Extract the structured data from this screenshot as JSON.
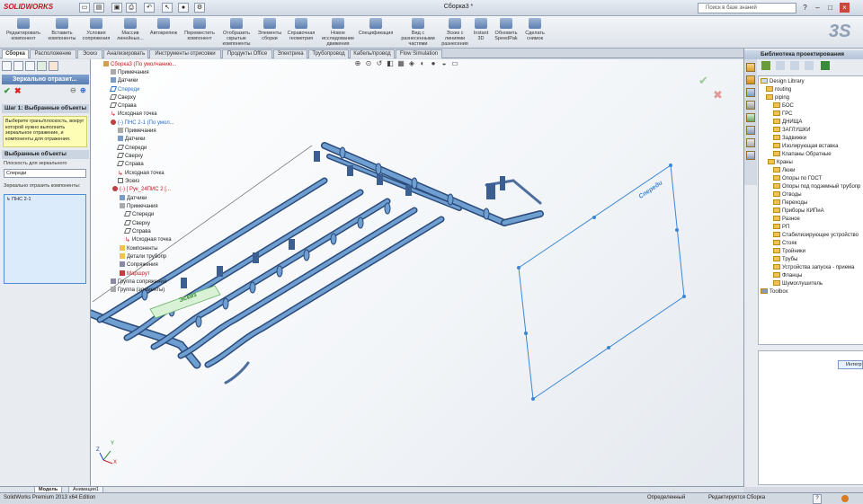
{
  "app": {
    "logo": "SOLIDWORKS",
    "doc_title": "Сборка3 *",
    "search_placeholder": "Поиск в базе знаний",
    "window_buttons": [
      "?",
      "–",
      "□",
      "×"
    ]
  },
  "quick_access": [
    "new-icon",
    "open-icon",
    "save-icon",
    "print-icon",
    "undo-icon",
    "select-icon",
    "rebuild-icon",
    "options-icon"
  ],
  "ribbon": {
    "buttons": [
      "Редактировать компонент",
      "Вставить компоненты",
      "Условия сопряжения",
      "Массив линейных...",
      "Автокрепеж",
      "Переместить компонент",
      "Отобразить скрытые компоненты",
      "Элементы сборки",
      "Справочная геометрия",
      "Новое исследование движения",
      "Спецификация",
      "Вид с разнесенными частями",
      "Эскиз с линиями разнесения",
      "Instant 3D",
      "Обновить SpeedPak",
      "Сделать снимок"
    ]
  },
  "tabs": [
    "Сборка",
    "Расположение",
    "Эскиз",
    "Анализировать",
    "Инструменты отрисовки",
    "Продукты Office",
    "Электрика",
    "Трубопровод",
    "Кабель/провод",
    "Flow Simulation"
  ],
  "property_manager": {
    "title": "Зеркально отразит...",
    "step_header": "Шаг 1: Выбранные объекты",
    "step_message": "Выберите грань/плоскость, вокруг которой нужно выполнить зеркальное отражение, и компоненты для отражения.",
    "selected_header": "Выбранные объекты",
    "plane_label": "Плоскость для зеркального",
    "plane_value": "Спереди",
    "components_label": "Зеркально отразить компоненты:",
    "components": [
      "ПНС 2-1"
    ]
  },
  "feature_tree": [
    "Сборка3 (По умолчанию...",
    "Примечания",
    "Датчики",
    "Спереди",
    "Сверху",
    "Справа",
    "Исходная точка",
    "(-) ПНС 2-1 (По умол...",
    "Примечания",
    "Датчики",
    "Спереди",
    "Сверху",
    "Справа",
    "Исходная точка",
    "Эскиз",
    "(-) [ Рук_24ПИС 2 [...",
    "Датчики",
    "Примечания",
    "Спереди",
    "Сверху",
    "Справа",
    "Исходная точка",
    "Компоненты",
    "Детали трубопр",
    "Сопряжения",
    "Маршрут",
    "Группа сопряжений",
    "Группа (элементы)"
  ],
  "viewport": {
    "plane_label": "Спереди",
    "sketch_label": "Эскиз",
    "triad": [
      "X",
      "Y",
      "Z"
    ]
  },
  "library": {
    "title": "Библиотека проектирования",
    "items": [
      "Design Library",
      "routing",
      "piping",
      "БОС",
      "ГРС",
      "ДНИЩА",
      "ЗАГЛУШКИ",
      "Задвижки",
      "Изолирующая вставка",
      "Клапаны Обратные",
      "Краны",
      "Люки",
      "Опоры по ГОСТ",
      "Опоры под подземный трубопр",
      "Отводы",
      "Переходы",
      "Приборы КИПиА",
      "Разное",
      "РП",
      "Стабилизирующее устройство",
      "Стояк",
      "Тройники",
      "Трубы",
      "Устройства запуска - приема",
      "Фланцы",
      "Шумоглушитель",
      "Toolbox"
    ],
    "side_badge": "Интегр"
  },
  "bottom_tabs": [
    "Модель",
    "Анимация1"
  ],
  "status": {
    "left": "SolidWorks Premium 2013 x64 Edition",
    "center1": "Определенный",
    "center2": "Редактируется Сборка",
    "right": "?"
  },
  "colors": {
    "pipe": "#6f9fd1",
    "pipe_dark": "#2a4a7a",
    "plane": "#3b86d6",
    "accent": "#c8141b",
    "tree_blue": "#2a6fc9"
  }
}
